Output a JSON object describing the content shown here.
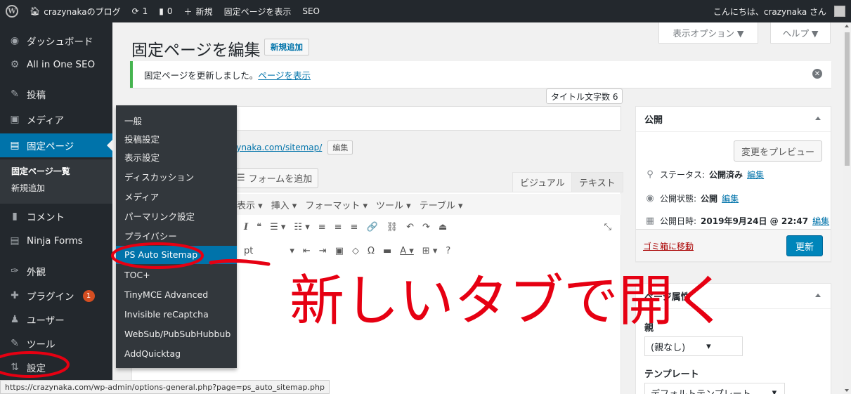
{
  "admin_bar": {
    "site_name": "crazynakaのブログ",
    "updates_count": "1",
    "comments_count": "0",
    "new_label": "新規",
    "view_page_label": "固定ページを表示",
    "seo_label": "SEO",
    "greeting": "こんにちは、crazynaka さん"
  },
  "sidebar": {
    "items": [
      {
        "label": "ダッシュボード",
        "icon": "dashboard-icon"
      },
      {
        "label": "All in One SEO",
        "icon": "gear-icon"
      },
      {
        "label": "投稿",
        "icon": "pin-icon"
      },
      {
        "label": "メディア",
        "icon": "media-icon"
      },
      {
        "label": "固定ページ",
        "icon": "page-icon"
      },
      {
        "label": "コメント",
        "icon": "comment-icon"
      },
      {
        "label": "Ninja Forms",
        "icon": "form-icon"
      },
      {
        "label": "外観",
        "icon": "brush-icon"
      },
      {
        "label": "プラグイン",
        "icon": "plugin-icon",
        "badge": "1"
      },
      {
        "label": "ユーザー",
        "icon": "user-icon"
      },
      {
        "label": "ツール",
        "icon": "wrench-icon"
      },
      {
        "label": "設定",
        "icon": "settings-icon"
      }
    ],
    "pages_submenu": [
      "固定ページ一覧",
      "新規追加"
    ]
  },
  "flyout": {
    "items": [
      "一般",
      "投稿設定",
      "表示設定",
      "ディスカッション",
      "メディア",
      "パーマリンク設定",
      "プライバシー",
      "PS Auto Sitemap",
      "TOC+",
      "TinyMCE Advanced",
      "Invisible reCaptcha",
      "WebSub/PubSubHubbub",
      "AddQuicktag"
    ]
  },
  "main": {
    "title": "固定ページを編集",
    "add_new": "新規追加",
    "screen_options": "表示オプション ▼",
    "help": "ヘルプ ▼",
    "notice_text": "固定ページを更新しました。",
    "notice_link": "ページを表示",
    "title_count": "タイトル文字数 6",
    "permalink_url": "zynaka.com/sitemap/",
    "permalink_edit": "編集",
    "add_form": "フォームを追加",
    "tab_visual": "ビジュアル",
    "tab_text": "テキスト",
    "toolbar_menus": [
      "表示 ▾",
      "挿入 ▾",
      "フォーマット ▾",
      "ツール ▾",
      "テーブル ▾"
    ],
    "toolbar_row2": [
      "I",
      "❝",
      "☰ ▾",
      "☷ ▾",
      "≡",
      "≡",
      "≡",
      "🔗",
      "⛓",
      "↶",
      "↷",
      "⏏"
    ],
    "toolbar_row3": [
      "pt",
      "▾",
      "⇤",
      "⇥",
      "▣",
      "◇",
      "Ω",
      "▬",
      "A ▾",
      "⊞ ▾",
      "?"
    ],
    "fullscreen_icon": "⤡"
  },
  "publish_box": {
    "title": "公開",
    "preview": "変更をプレビュー",
    "status_label": "ステータス: ",
    "status_value": "公開済み",
    "visibility_label": "公開状態: ",
    "visibility_value": "公開",
    "date_label": "公開日時: ",
    "date_value": "2019年9月24日 @ 22:47",
    "edit_link": "編集",
    "trash": "ゴミ箱に移動",
    "update": "更新"
  },
  "attributes_box": {
    "title": "ページ属性",
    "parent_label": "親",
    "parent_value": "(親なし)",
    "template_label": "テンプレート",
    "template_value": "デフォルトテンプレート"
  },
  "status_bar": {
    "url": "https://crazynaka.com/wp-admin/options-general.php?page=ps_auto_sitemap.php"
  },
  "annotation": {
    "text": "新しいタブで開く",
    "color": "#e60012"
  },
  "colors": {
    "admin_bar": "#23282d",
    "accent": "#0073aa",
    "update_button": "#0085ba",
    "badge": "#d54e21"
  }
}
